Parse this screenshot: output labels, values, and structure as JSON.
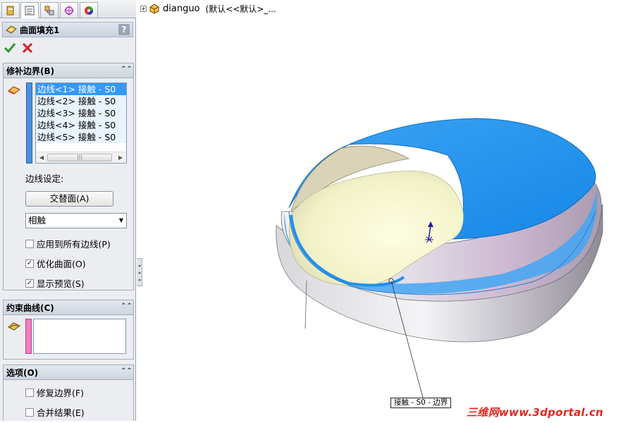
{
  "tabs": [
    {
      "name": "feature-manager-tab"
    },
    {
      "name": "property-manager-tab"
    },
    {
      "name": "configuration-manager-tab"
    },
    {
      "name": "dimxpert-tab"
    },
    {
      "name": "display-manager-tab"
    }
  ],
  "feature": {
    "title": "曲面填充1",
    "help": "?"
  },
  "boundary": {
    "header": "修补边界(B)",
    "edges": [
      "边线<1> 接触 - S0",
      "边线<2> 接触 - S0",
      "边线<3> 接触 - S0",
      "边线<4> 接触 - S0",
      "边线<5> 接触 - S0"
    ],
    "edge_setting_label": "边线设定:",
    "alternate_face_button": "交替面(A)",
    "curvature_select_value": "相触",
    "apply_all_label": "应用到所有边线(P)",
    "optimize_label": "优化曲面(O)",
    "preview_label": "显示预览(S)",
    "apply_all_checked": false,
    "optimize_checked": true,
    "preview_checked": true
  },
  "constraint": {
    "header": "约束曲线(C)"
  },
  "options": {
    "header": "选项(O)",
    "fix_boundary_label": "修复边界(F)",
    "merge_result_label": "合并结果(E)",
    "fix_boundary_checked": false,
    "merge_result_checked": false
  },
  "tree": {
    "expand": "+",
    "part_name": "dianguo",
    "config": "(默认<<默认>_..."
  },
  "viewport": {
    "callout": "接触 - S0 - 边界",
    "watermark": "三维网www.3dportal.cn"
  },
  "colors": {
    "accent_blue": "#3399ff",
    "surface_blue": "#1f95ef",
    "watermark_red": "#e3261c",
    "contact_strip_blue": "#4a90e2",
    "constraint_strip_pink": "#f27cc0"
  }
}
